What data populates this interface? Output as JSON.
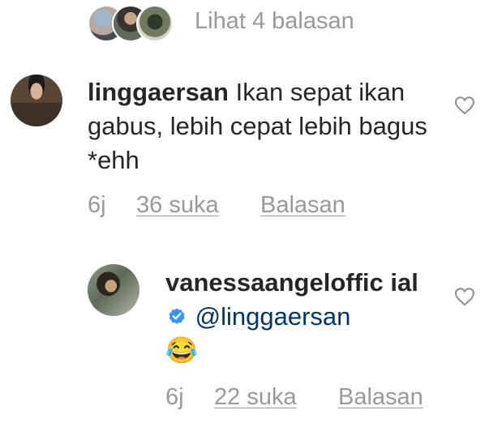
{
  "replies_toggle": {
    "label": "Lihat 4 balasan",
    "avatar_count": 3
  },
  "comments": [
    {
      "username": "linggaersan",
      "text": "Ikan sepat ikan gabus, lebih cepat lebih bagus *ehh",
      "time": "6j",
      "likes": "36 suka",
      "reply": "Balasan",
      "avatar_icon": "profile-photo"
    },
    {
      "username": "vanessaangeloffic ial",
      "verified": true,
      "mention": "@linggaersan",
      "emoji": "😂",
      "time": "6j",
      "likes": "22 suka",
      "reply": "Balasan",
      "avatar_icon": "profile-photo"
    }
  ],
  "icons": {
    "like": "heart-outline-icon",
    "verified": "verified-badge-icon"
  },
  "colors": {
    "text": "#262626",
    "muted": "#999999",
    "mention": "#003569",
    "verified": "#3897f0"
  }
}
